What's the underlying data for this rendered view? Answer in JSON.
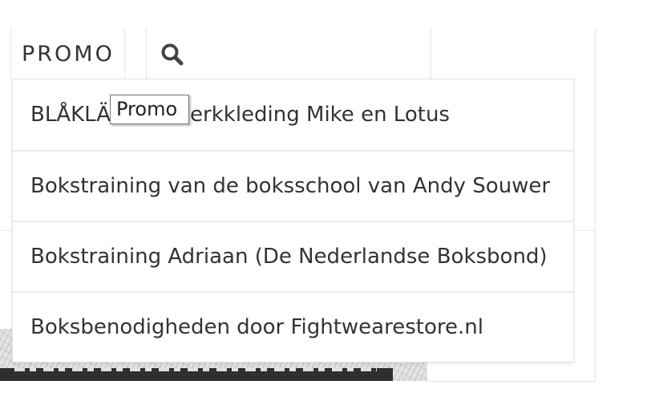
{
  "nav": {
    "promo_label": "PROMO",
    "search_icon": "search-icon"
  },
  "tooltip": {
    "text": "Promo"
  },
  "dropdown": {
    "items": [
      {
        "label_part_1": "BLÅKLÄ",
        "label_part_2": "erkkleding Mike en Lotus"
      },
      {
        "label": "Bokstraining van de boksschool van Andy Souwer"
      },
      {
        "label": "Bokstraining Adriaan (De Nederlandse Boksbond)"
      },
      {
        "label": "Boksbenodigheden door Fightwearestore.nl"
      }
    ]
  },
  "colors": {
    "text": "#333333",
    "icon": "#444444",
    "divider": "#e6e6e6",
    "caption": "#2f2f2f",
    "tip_border": "#767676"
  }
}
